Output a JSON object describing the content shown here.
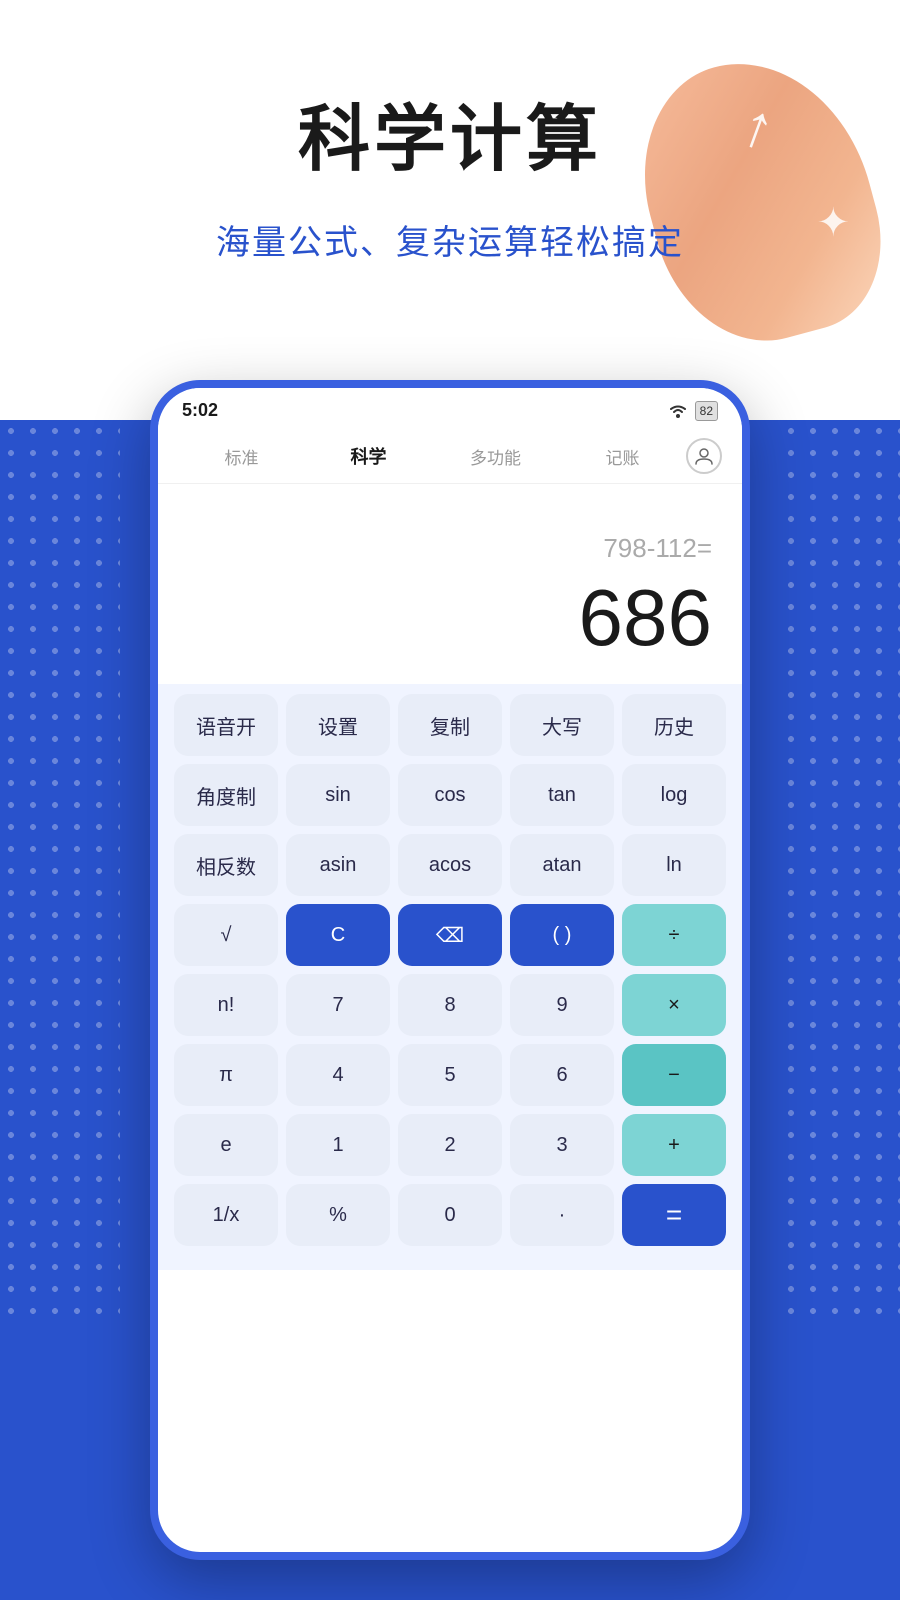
{
  "background": {
    "top_color": "#ffffff",
    "bottom_color": "#2952cc"
  },
  "title": {
    "main": "科学计算",
    "subtitle": "海量公式、复杂运算轻松搞定"
  },
  "status_bar": {
    "time": "5:02",
    "battery": "82"
  },
  "tabs": [
    {
      "label": "标准",
      "active": false
    },
    {
      "label": "科学",
      "active": true
    },
    {
      "label": "多功能",
      "active": false
    },
    {
      "label": "记账",
      "active": false
    }
  ],
  "display": {
    "expression": "798-112=",
    "result": "686"
  },
  "keypad": {
    "rows": [
      [
        {
          "label": "语音开",
          "style": "light"
        },
        {
          "label": "设置",
          "style": "light"
        },
        {
          "label": "复制",
          "style": "light"
        },
        {
          "label": "大写",
          "style": "light"
        },
        {
          "label": "历史",
          "style": "light"
        }
      ],
      [
        {
          "label": "角度制",
          "style": "light"
        },
        {
          "label": "sin",
          "style": "light"
        },
        {
          "label": "cos",
          "style": "light"
        },
        {
          "label": "tan",
          "style": "light"
        },
        {
          "label": "log",
          "style": "light"
        }
      ],
      [
        {
          "label": "相反数",
          "style": "light"
        },
        {
          "label": "asin",
          "style": "light"
        },
        {
          "label": "acos",
          "style": "light"
        },
        {
          "label": "atan",
          "style": "light"
        },
        {
          "label": "ln",
          "style": "light"
        }
      ],
      [
        {
          "label": "√",
          "style": "light"
        },
        {
          "label": "C",
          "style": "dark-blue"
        },
        {
          "label": "⌫",
          "style": "dark-blue"
        },
        {
          "label": "( )",
          "style": "dark-blue"
        },
        {
          "label": "÷",
          "style": "teal"
        }
      ],
      [
        {
          "label": "n!",
          "style": "light"
        },
        {
          "label": "7",
          "style": "light"
        },
        {
          "label": "8",
          "style": "light"
        },
        {
          "label": "9",
          "style": "light"
        },
        {
          "label": "×",
          "style": "teal"
        }
      ],
      [
        {
          "label": "π",
          "style": "light"
        },
        {
          "label": "4",
          "style": "light"
        },
        {
          "label": "5",
          "style": "light"
        },
        {
          "label": "6",
          "style": "light"
        },
        {
          "label": "−",
          "style": "teal-mid"
        }
      ],
      [
        {
          "label": "e",
          "style": "light"
        },
        {
          "label": "1",
          "style": "light"
        },
        {
          "label": "2",
          "style": "light"
        },
        {
          "label": "3",
          "style": "light"
        },
        {
          "label": "+",
          "style": "teal"
        }
      ],
      [
        {
          "label": "1/x",
          "style": "light"
        },
        {
          "label": "%",
          "style": "light"
        },
        {
          "label": "0",
          "style": "light"
        },
        {
          "label": "·",
          "style": "light"
        },
        {
          "label": "=",
          "style": "equals"
        }
      ]
    ]
  }
}
